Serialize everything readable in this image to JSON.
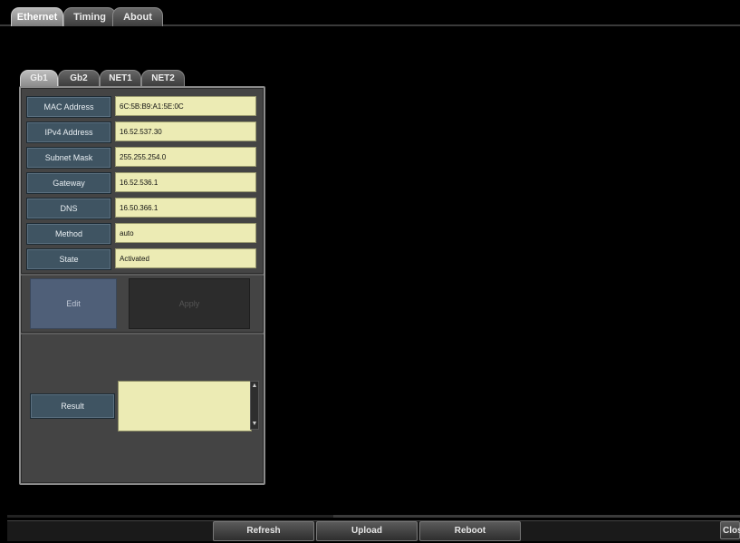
{
  "top_tabs": [
    {
      "label": "Ethernet",
      "active": true
    },
    {
      "label": "Timing",
      "active": false
    },
    {
      "label": "About",
      "active": false
    }
  ],
  "inner_tabs": [
    {
      "label": "Gb1",
      "active": true
    },
    {
      "label": "Gb2",
      "active": false
    },
    {
      "label": "NET1",
      "active": false
    },
    {
      "label": "NET2",
      "active": false
    }
  ],
  "fields": [
    {
      "label": "MAC Address",
      "value": "6C:5B:B9:A1:5E:0C"
    },
    {
      "label": "IPv4 Address",
      "value": "16.52.537.30"
    },
    {
      "label": "Subnet Mask",
      "value": "255.255.254.0"
    },
    {
      "label": "Gateway",
      "value": "16.52.536.1"
    },
    {
      "label": "DNS",
      "value": "16.50.366.1"
    },
    {
      "label": "Method",
      "value": "auto"
    },
    {
      "label": "State",
      "value": "Activated"
    }
  ],
  "actions": {
    "edit_label": "Edit",
    "apply_label": "Apply"
  },
  "result": {
    "label": "Result",
    "value": ""
  },
  "bottom_buttons": {
    "refresh": "Refresh",
    "upload": "Upload",
    "reboot": "Reboot",
    "close": "Clos"
  },
  "colors": {
    "background": "#000000",
    "label_bg": "#3f5462",
    "value_bg": "#ecebb4",
    "edit_bg": "#4f5f78",
    "panel_bg": "#444444"
  }
}
